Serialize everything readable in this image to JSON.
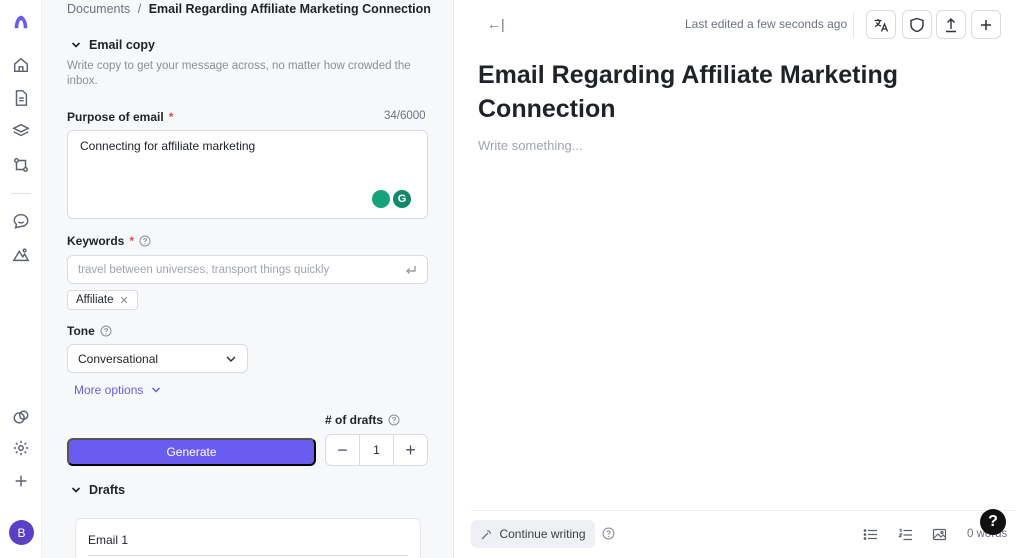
{
  "breadcrumb": {
    "root": "Documents",
    "separator": "/",
    "current": "Email Regarding Affiliate Marketing Connection"
  },
  "form": {
    "section_title": "Email copy",
    "section_description": "Write copy to get your message across, no matter how crowded the inbox.",
    "purpose": {
      "label": "Purpose of email",
      "required_mark": "*",
      "counter": "34/6000",
      "value": "Connecting for affiliate marketing"
    },
    "keywords": {
      "label": "Keywords",
      "required_mark": "*",
      "placeholder": "travel between universes, transport things quickly",
      "tags": [
        "Affiliate"
      ]
    },
    "tone": {
      "label": "Tone",
      "selected": "Conversational"
    },
    "more_options": "More options",
    "drafts_count": {
      "label": "# of drafts",
      "value": "1",
      "minus": "−",
      "plus": "+"
    },
    "generate_label": "Generate",
    "drafts_title": "Drafts",
    "draft_card_title": "Email 1",
    "grammarly_letter": "G"
  },
  "editor": {
    "last_edited": "Last edited a few seconds ago",
    "title": "Email Regarding Affiliate Marketing Connection",
    "placeholder": "Write something...",
    "continue_writing": "Continue writing",
    "word_count": "0 words",
    "help_symbol": "?"
  },
  "user": {
    "avatar_initial": "B"
  },
  "colors": {
    "accent": "#6a5cf0",
    "link": "#6a5cd8",
    "avatar": "#5b3fc4",
    "required": "#e5484d"
  },
  "icons": {
    "rail": [
      "logo-icon",
      "home-icon",
      "document-icon",
      "layers-icon",
      "workflow-icon",
      "chat-icon",
      "image-icon",
      "circles-icon",
      "settings-icon",
      "plus-icon"
    ],
    "toolbar": [
      "translate-icon",
      "shield-icon",
      "upload-icon",
      "plus-icon"
    ],
    "bottom": [
      "bullet-list-icon",
      "numbered-list-icon",
      "image-icon"
    ]
  }
}
